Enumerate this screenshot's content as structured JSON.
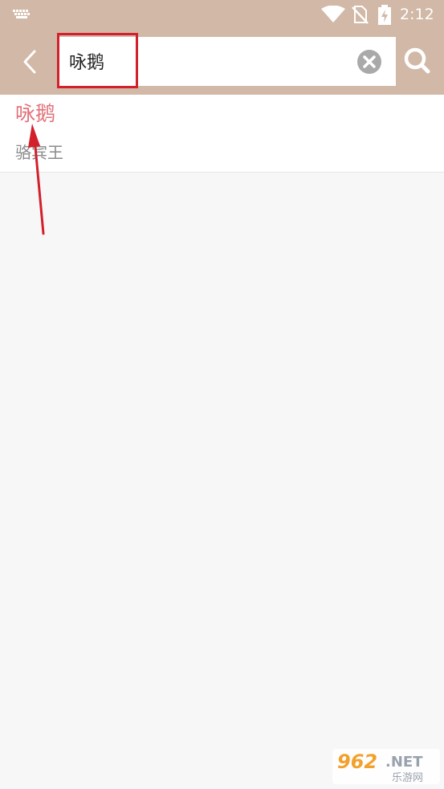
{
  "status_bar": {
    "time": "2:12",
    "icons": [
      "keyboard-icon",
      "wifi-icon",
      "no-sim-icon",
      "battery-charging-icon"
    ],
    "color": "#ffffff"
  },
  "colors": {
    "header_bg": "#d2b8a6",
    "page_bg": "#f7f7f7",
    "title_accent": "#e2737b",
    "annotation_red": "#d2202c"
  },
  "toolbar": {
    "back_icon": "chevron-left-icon",
    "search_value": "咏鹅",
    "search_placeholder": "",
    "clear_icon": "clear-circle-icon",
    "search_icon": "search-icon"
  },
  "results": [
    {
      "title": "咏鹅",
      "author": "骆宾王"
    }
  ],
  "watermark": {
    "logo_text": "962.NET",
    "sub_text": "乐游网"
  }
}
